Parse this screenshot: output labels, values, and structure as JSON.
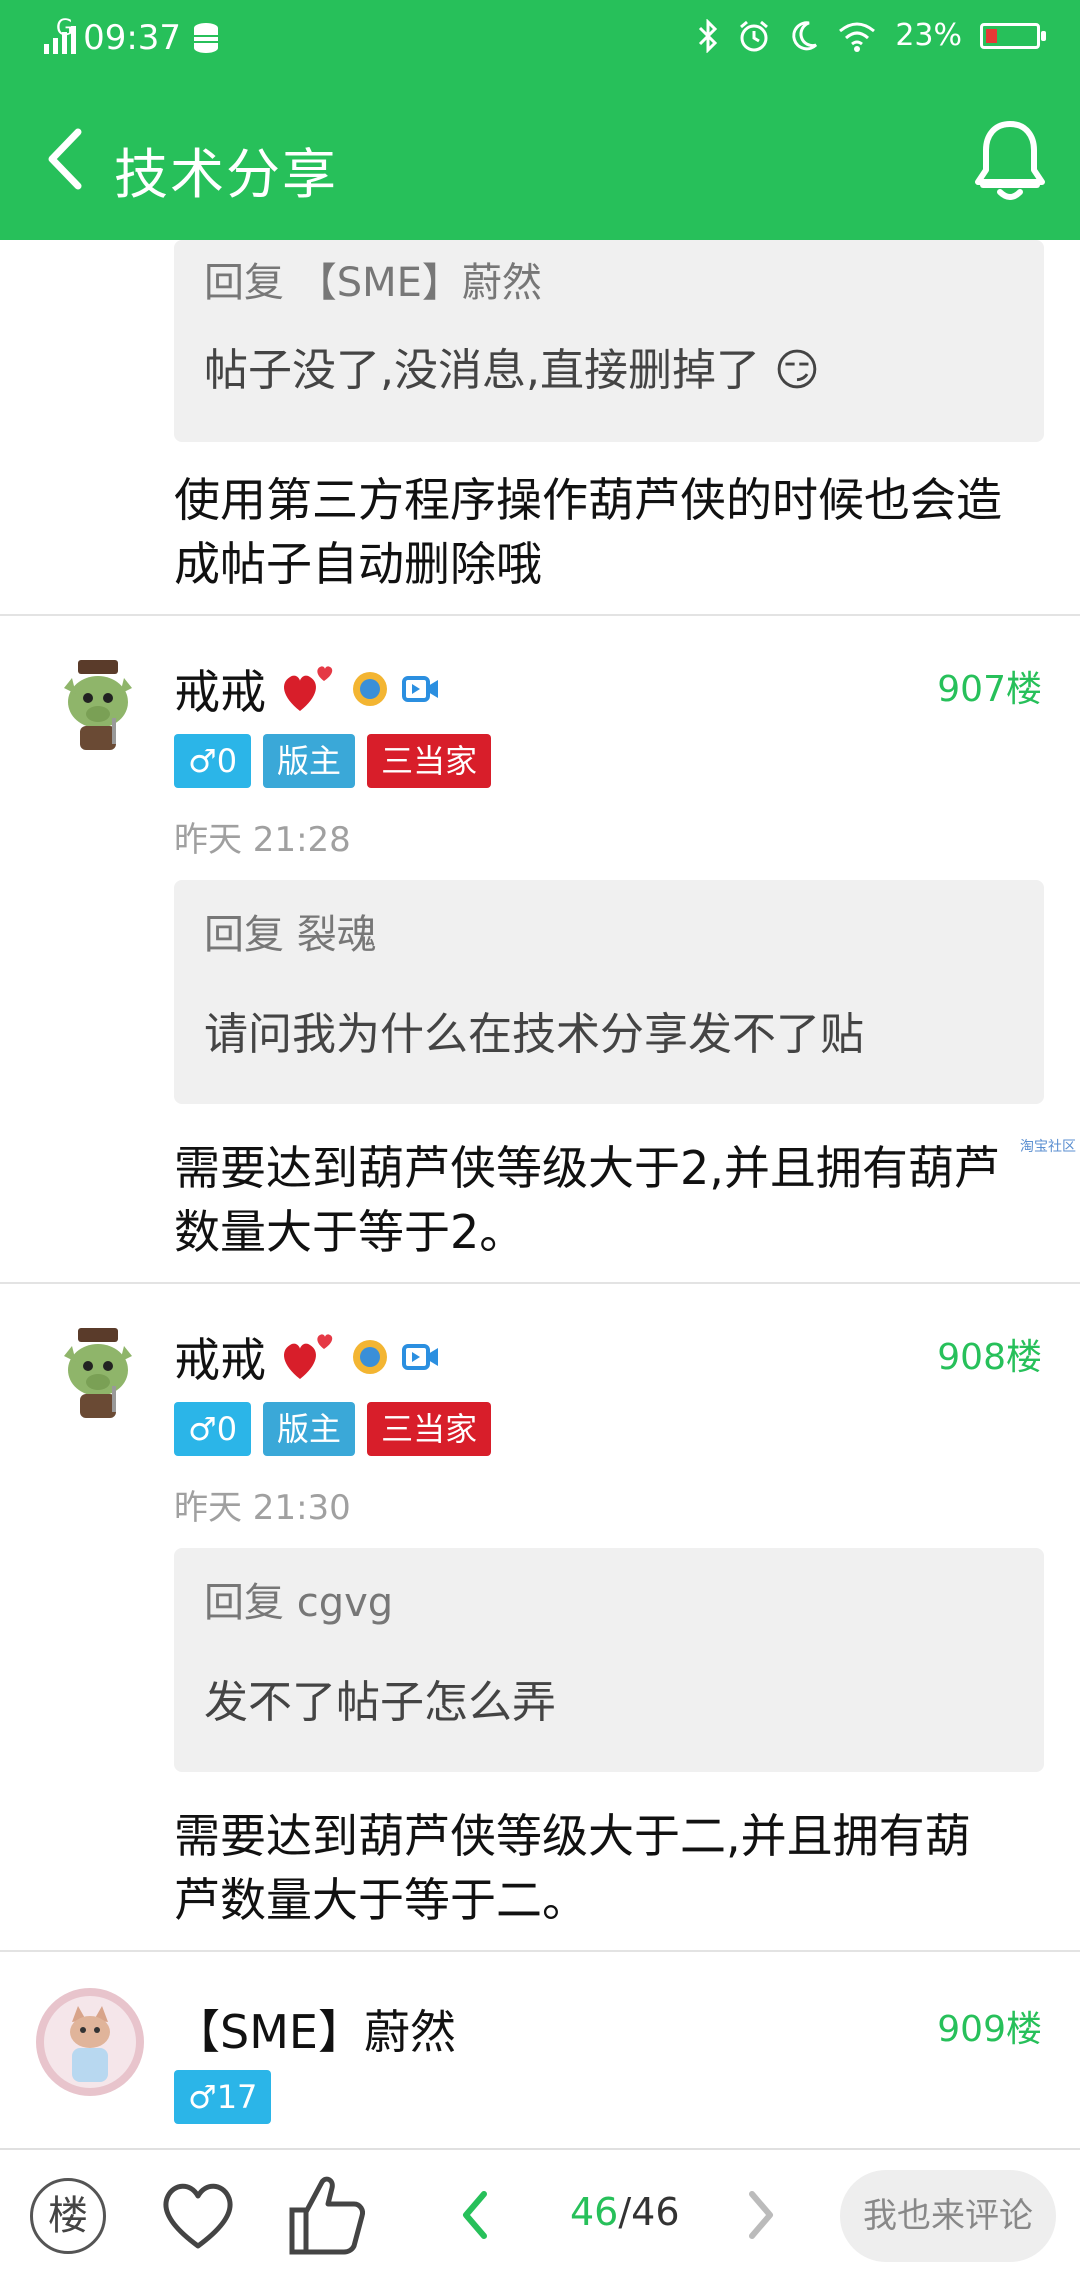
{
  "status": {
    "time": "09:37",
    "network": "G",
    "battery_text": "23%",
    "battery_level": 0.23
  },
  "appbar": {
    "title": "技术分享"
  },
  "top_post": {
    "quote_head": "回复 【SME】蔚然",
    "quote_text": "帖子没了,没消息,直接删掉了 😏",
    "body_lines": [
      "使用第三方程序操作葫芦侠的时候也会造",
      "成帖子自动删除哦"
    ]
  },
  "posts": [
    {
      "username": "戒戒",
      "floor": "907楼",
      "badges": [
        "♂0",
        "版主",
        "三当家"
      ],
      "time": "昨天 21:28",
      "quote_head": "回复 裂魂",
      "quote_text": "请问我为什么在技术分享发不了贴",
      "body_lines": [
        "需要达到葫芦侠等级大于2,并且拥有葫芦",
        "数量大于等于2。"
      ],
      "watermark": "淘宝社区"
    },
    {
      "username": "戒戒",
      "floor": "908楼",
      "badges": [
        "♂0",
        "版主",
        "三当家"
      ],
      "time": "昨天 21:30",
      "quote_head": "回复 cgvg",
      "quote_text": "发不了帖子怎么弄",
      "body_lines": [
        "需要达到葫芦侠等级大于二,并且拥有葫",
        "芦数量大于等于二。"
      ]
    },
    {
      "username": "【SME】蔚然",
      "floor": "909楼",
      "badges": [
        "♂17"
      ]
    }
  ],
  "bottombar": {
    "floor_label": "楼",
    "page_current": "46",
    "page_sep": "/",
    "page_total": "46",
    "comment_label": "我也来评论"
  },
  "colors": {
    "accent": "#27c05a",
    "badge_blue": "#2bb5e8",
    "badge_red": "#d81e2a"
  }
}
